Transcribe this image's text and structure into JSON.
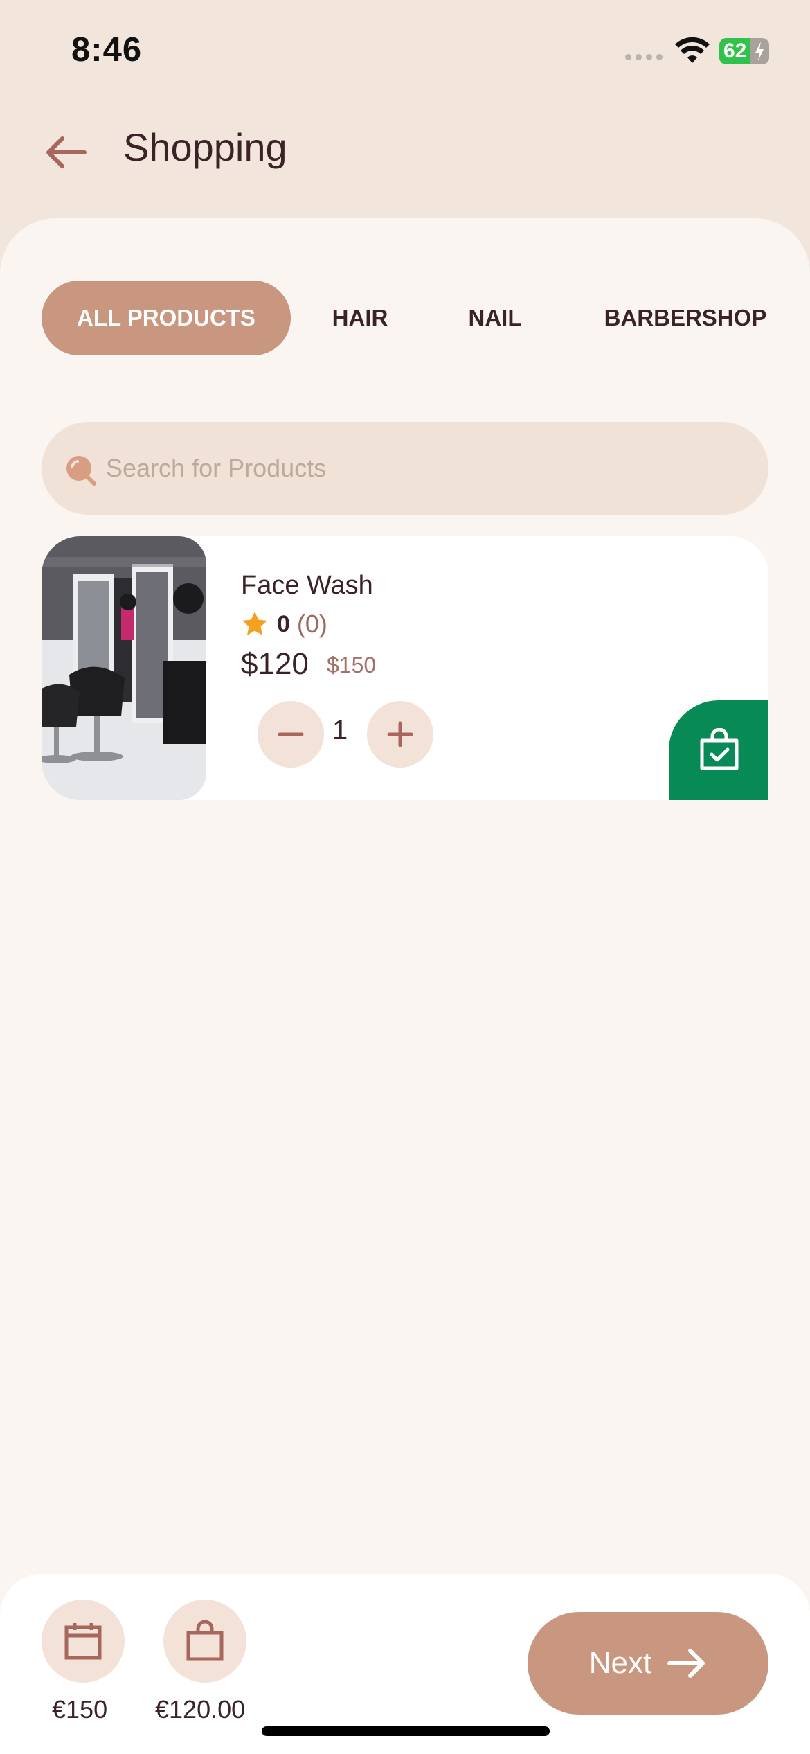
{
  "status_bar": {
    "time": "8:46",
    "battery": "62",
    "battery_level": 0.62
  },
  "header": {
    "title": "Shopping"
  },
  "tabs": [
    {
      "label": "ALL PRODUCTS",
      "active": true
    },
    {
      "label": "HAIR",
      "active": false
    },
    {
      "label": "NAIL",
      "active": false
    },
    {
      "label": "BARBERSHOP",
      "active": false
    }
  ],
  "search": {
    "placeholder": "Search for Products",
    "value": ""
  },
  "products": [
    {
      "name": "Face Wash",
      "rating": "0",
      "reviews": "(0)",
      "price": "$120",
      "old_price": "$150",
      "quantity": "1"
    }
  ],
  "bottom_bar": {
    "booking_total": "€150",
    "products_total": "€120.00",
    "next_label": "Next"
  },
  "colors": {
    "accent": "#c9977f",
    "cart_green": "#078a55",
    "background": "#f2e5dc"
  }
}
